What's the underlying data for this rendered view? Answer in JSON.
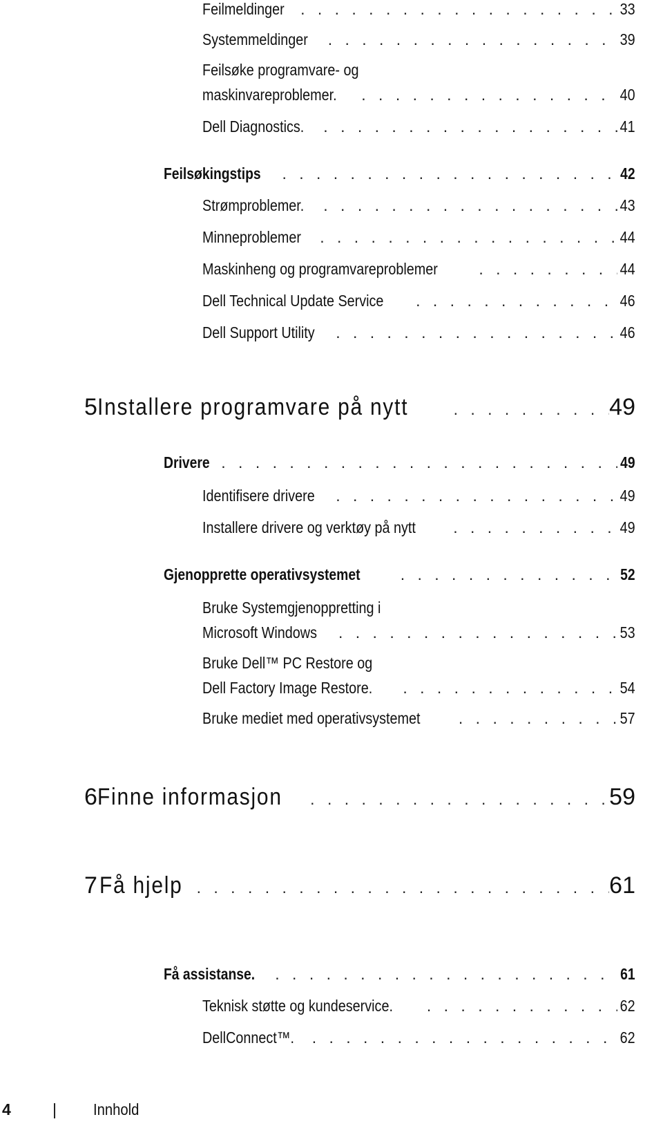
{
  "toc": {
    "entries": [
      {
        "level": 3,
        "title": "Feilmeldinger",
        "page": "33"
      },
      {
        "level": 3,
        "title": "Systemmeldinger",
        "page": "39"
      },
      {
        "level": 3,
        "title_line1": "Feilsøke programvare- og",
        "title": "maskinvareproblemer.",
        "page": "40"
      },
      {
        "level": 3,
        "title": "Dell Diagnostics.",
        "page": "41"
      },
      {
        "level": 2,
        "title": "Feilsøkingstips",
        "page": "42"
      },
      {
        "level": 3,
        "title": "Strømproblemer.",
        "page": "43"
      },
      {
        "level": 3,
        "title": "Minneproblemer",
        "page": "44"
      },
      {
        "level": 3,
        "title": "Maskinheng og programvareproblemer",
        "page": "44"
      },
      {
        "level": 3,
        "title": "Dell Technical Update Service",
        "page": "46"
      },
      {
        "level": 3,
        "title": "Dell Support Utility",
        "page": "46"
      },
      {
        "level": 1,
        "number": "5",
        "title": "Installere programvare på nytt",
        "page": "49"
      },
      {
        "level": 2,
        "title": "Drivere",
        "page": "49"
      },
      {
        "level": 3,
        "title": "Identifisere drivere",
        "page": "49"
      },
      {
        "level": 3,
        "title": "Installere drivere og verktøy på nytt",
        "page": "49"
      },
      {
        "level": 2,
        "title": "Gjenopprette operativsystemet",
        "page": "52"
      },
      {
        "level": 3,
        "title_line1": "Bruke Systemgjenoppretting i",
        "title": "Microsoft Windows",
        "page": "53"
      },
      {
        "level": 3,
        "title_line1": "Bruke Dell™ PC Restore og",
        "title": "Dell Factory Image Restore.",
        "page": "54"
      },
      {
        "level": 3,
        "title": "Bruke mediet med operativsystemet",
        "page": "57"
      },
      {
        "level": 1,
        "number": "6",
        "title": "Finne informasjon",
        "page": "59"
      },
      {
        "level": 1,
        "number": "7",
        "title": "Få hjelp",
        "page": "61"
      },
      {
        "level": 2,
        "title": "Få assistanse.",
        "page": "61"
      },
      {
        "level": 3,
        "title": "Teknisk støtte og kundeservice.",
        "page": "62"
      },
      {
        "level": 3,
        "title": "DellConnect™.",
        "page": "62"
      }
    ]
  },
  "footer": {
    "page_number": "4",
    "section": "Innhold"
  }
}
